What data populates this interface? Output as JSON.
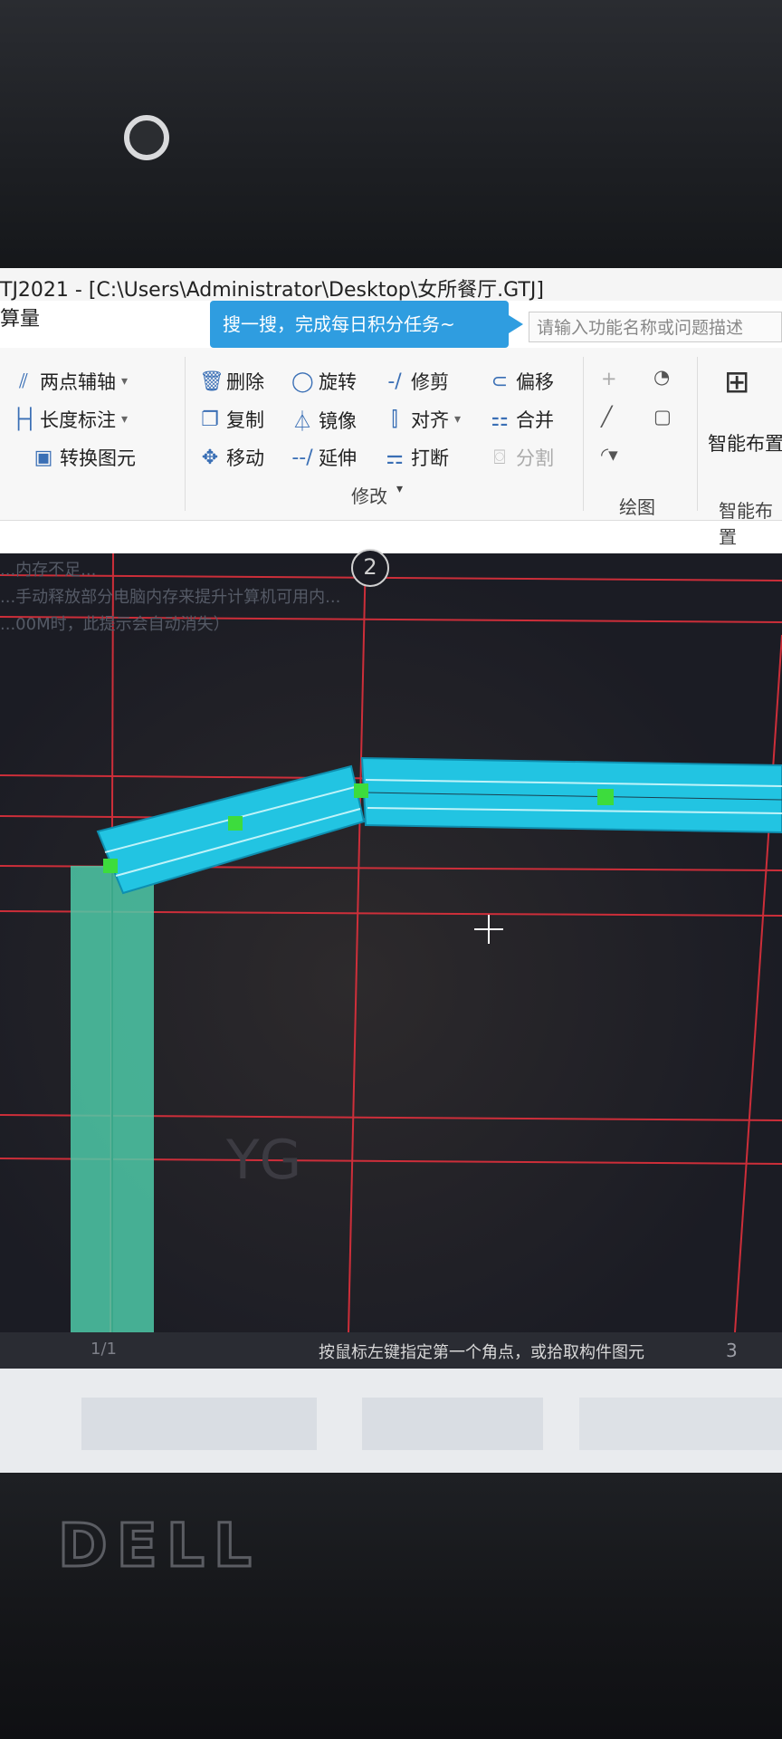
{
  "window": {
    "title": "TJ2021 - [C:\\Users\\Administrator\\Desktop\\女所餐厅.GTJ]",
    "menu_fragment": "算量"
  },
  "search": {
    "tip": "搜一搜，完成每日积分任务~",
    "placeholder": "请输入功能名称或问题描述"
  },
  "ribbon": {
    "axis_group": {
      "two_point_axis": "两点辅轴",
      "length_dimension": "长度标注",
      "convert_primitive": "转换图元"
    },
    "modify_group": {
      "label": "修改",
      "delete": "删除",
      "rotate": "旋转",
      "trim": "修剪",
      "offset": "偏移",
      "copy": "复制",
      "mirror": "镜像",
      "align": "对齐",
      "merge": "合并",
      "move": "移动",
      "extend": "延伸",
      "break": "打断",
      "split": "分割"
    },
    "draw_group": {
      "label": "绘图"
    },
    "smart_group": {
      "label": "智能布置",
      "button": "智能布置"
    }
  },
  "canvas": {
    "hint_lines": [
      "...内存不足...",
      "...手动释放部分电脑内存来提升计算机可用内...",
      "...00M时，此提示会自动消失）"
    ],
    "axis_number": "2",
    "watermark": "YG"
  },
  "status_bar": {
    "page": "1/1",
    "prompt": "按鼠标左键指定第一个角点，或拾取构件图元",
    "layer": "3"
  },
  "colors": {
    "beam_fill": "#22c4e2",
    "column_fill": "#4ec9a8",
    "grid_line": "#e0303c",
    "grip": "#3ddc3d",
    "canvas_bg": "#1b1c24",
    "tip_bg": "#2f9de0"
  }
}
